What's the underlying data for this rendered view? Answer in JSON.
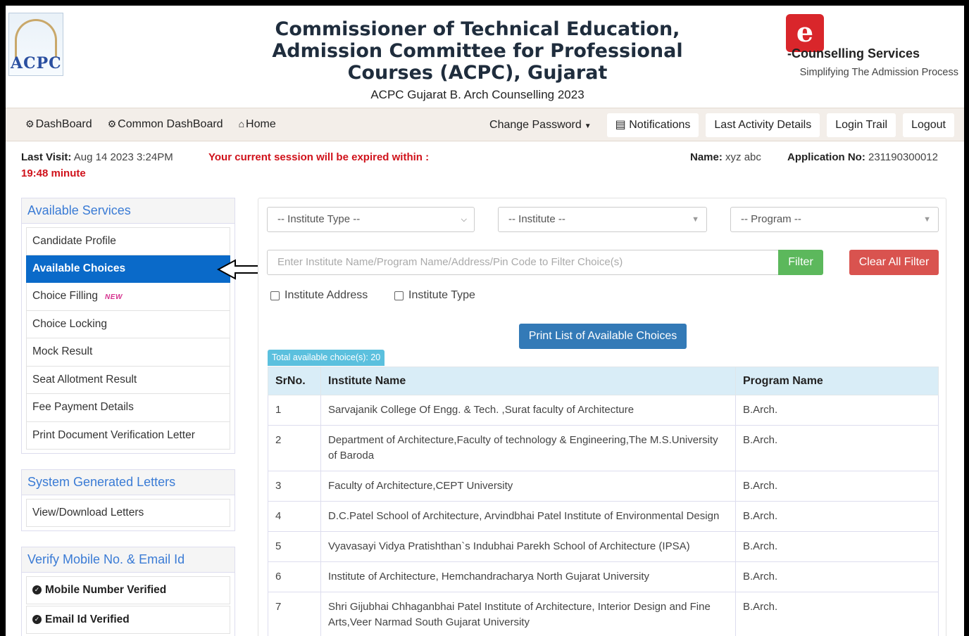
{
  "header": {
    "logo_text": "ACPC",
    "title_line1": "Commissioner of Technical Education,",
    "title_line2": "Admission Committee for Professional",
    "title_line3": "Courses (ACPC), Gujarat",
    "subtitle": "ACPC Gujarat B. Arch Counselling 2023",
    "brand_logo_letter": "e",
    "brand_name": "-Counselling Services",
    "brand_tagline": "Simplifying The Admission Process"
  },
  "nav": {
    "dashboard": "DashBoard",
    "common_dashboard": "Common DashBoard",
    "home": "Home",
    "change_password": "Change Password",
    "notifications": "Notifications",
    "last_activity": "Last Activity Details",
    "login_trail": "Login Trail",
    "logout": "Logout"
  },
  "info": {
    "last_visit_label": "Last Visit:",
    "last_visit_value": "Aug 14 2023 3:24PM",
    "session_text": "Your current session will be expired within :",
    "session_remaining": "19:48 minute",
    "name_label": "Name:",
    "name_value": "xyz abc",
    "appno_label": "Application No:",
    "appno_value": "231190300012"
  },
  "sidebar": {
    "services_title": "Available Services",
    "services": [
      {
        "label": "Candidate Profile"
      },
      {
        "label": "Available Choices"
      },
      {
        "label": "Choice Filling",
        "badge": "NEW"
      },
      {
        "label": "Choice Locking"
      },
      {
        "label": "Mock Result"
      },
      {
        "label": "Seat Allotment Result"
      },
      {
        "label": "Fee Payment Details"
      },
      {
        "label": "Print Document Verification Letter"
      }
    ],
    "letters_title": "System Generated Letters",
    "letters_item": "View/Download Letters",
    "verify_title": "Verify Mobile No. & Email Id",
    "mobile_verified": "Mobile Number Verified",
    "email_verified": "Email Id Verified"
  },
  "filters": {
    "institute_type": "-- Institute Type --",
    "institute": "-- Institute --",
    "program": "-- Program --",
    "search_placeholder": "Enter Institute Name/Program Name/Address/Pin Code to Filter Choice(s)",
    "filter_btn": "Filter",
    "clear_btn": "Clear All Filter",
    "chk_address": "Institute Address",
    "chk_type": "Institute Type"
  },
  "print_btn": "Print List of Available Choices",
  "total_badge": "Total available choice(s): 20",
  "table": {
    "headers": [
      "SrNo.",
      "Institute Name",
      "Program Name"
    ],
    "rows": [
      [
        "1",
        "Sarvajanik College Of Engg. & Tech. ,Surat faculty of Architecture",
        "B.Arch."
      ],
      [
        "2",
        "Department of Architecture,Faculty of technology & Engineering,The M.S.University of Baroda",
        "B.Arch."
      ],
      [
        "3",
        "Faculty of Architecture,CEPT University",
        "B.Arch."
      ],
      [
        "4",
        "D.C.Patel School of Architecture, Arvindbhai Patel Institute of Environmental Design",
        "B.Arch."
      ],
      [
        "5",
        "Vyavasayi Vidya Pratishthan`s Indubhai Parekh School of Architecture (IPSA)",
        "B.Arch."
      ],
      [
        "6",
        "Institute of Architecture, Hemchandracharya North Gujarat University",
        "B.Arch."
      ],
      [
        "7",
        "Shri Gijubhai Chhaganbhai Patel Institute of Architecture, Interior Design and Fine Arts,Veer Narmad South Gujarat University",
        "B.Arch."
      ]
    ]
  },
  "colors": {
    "active_blue": "#0a6ac9",
    "session_red": "#d0121b",
    "filter_green": "#5cb85c",
    "clear_red": "#d9534f",
    "print_blue": "#337ab7",
    "badge_cyan": "#5bc0de"
  }
}
